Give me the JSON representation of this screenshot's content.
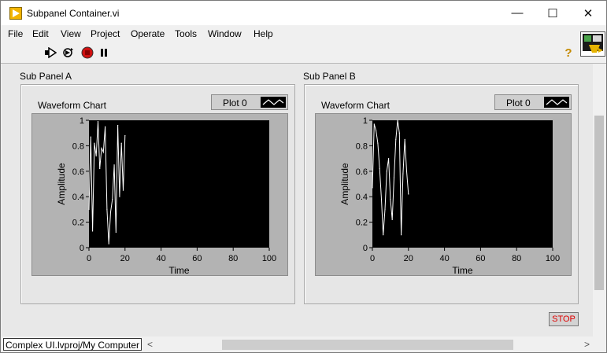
{
  "window": {
    "title": "Subpanel Container.vi",
    "controls": {
      "minimize": "—",
      "maximize": "☐",
      "close": "✕"
    }
  },
  "menu": [
    "File",
    "Edit",
    "View",
    "Project",
    "Operate",
    "Tools",
    "Window",
    "Help"
  ],
  "toolbar": {
    "icons": [
      "run-arrow-icon",
      "run-continuously-icon",
      "abort-icon",
      "pause-icon"
    ],
    "help_label": "?"
  },
  "subpanels": [
    {
      "label": "Sub Panel A",
      "chart": {
        "title": "Waveform Chart",
        "legend": "Plot 0"
      }
    },
    {
      "label": "Sub Panel B",
      "chart": {
        "title": "Waveform Chart",
        "legend": "Plot 0"
      }
    }
  ],
  "chart_data": [
    {
      "type": "line",
      "title": "Waveform Chart",
      "xlabel": "Time",
      "ylabel": "Amplitude",
      "xlim": [
        0,
        100
      ],
      "ylim": [
        0,
        1
      ],
      "xticks": [
        0,
        20,
        40,
        60,
        80,
        100
      ],
      "yticks": [
        0,
        0.2,
        0.4,
        0.6,
        0.8,
        1
      ],
      "series": [
        {
          "name": "Plot 0",
          "x": [
            0,
            1,
            2,
            3,
            4,
            5,
            6,
            7,
            8,
            9,
            10,
            11,
            12,
            13,
            14,
            15,
            16,
            17,
            18,
            19,
            20
          ],
          "values": [
            0.3,
            0.87,
            0.13,
            0.82,
            0.72,
            0.99,
            0.62,
            0.78,
            0.75,
            0.95,
            0.3,
            0.03,
            0.28,
            0.38,
            0.65,
            0.12,
            0.96,
            0.4,
            0.82,
            0.45,
            0.88
          ]
        }
      ]
    },
    {
      "type": "line",
      "title": "Waveform Chart",
      "xlabel": "Time",
      "ylabel": "Amplitude",
      "xlim": [
        0,
        100
      ],
      "ylim": [
        0,
        1
      ],
      "xticks": [
        0,
        20,
        40,
        60,
        80,
        100
      ],
      "yticks": [
        0,
        0.2,
        0.4,
        0.6,
        0.8,
        1
      ],
      "series": [
        {
          "name": "Plot 0",
          "x": [
            0,
            1,
            2,
            3,
            4,
            5,
            6,
            7,
            8,
            9,
            10,
            11,
            12,
            13,
            14,
            15,
            16,
            17,
            18,
            19,
            20
          ],
          "values": [
            0.47,
            0.97,
            0.92,
            0.82,
            0.62,
            0.38,
            0.1,
            0.3,
            0.6,
            0.7,
            0.38,
            0.22,
            0.55,
            0.85,
            1.0,
            0.9,
            0.1,
            0.58,
            0.85,
            0.6,
            0.42
          ]
        }
      ]
    }
  ],
  "stop_button": "STOP",
  "status": {
    "project_path": "Complex UI.lvproj/My Computer",
    "left_arrow": "<",
    "right_arrow": ">"
  },
  "colors": {
    "plot_bg": "#000000",
    "trace": "#ffffff",
    "stop_text": "#e00000"
  }
}
